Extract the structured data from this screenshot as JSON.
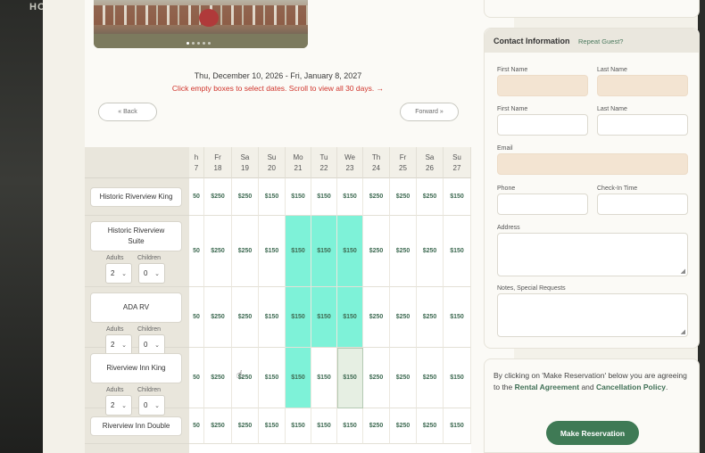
{
  "site": {
    "nav_fragment": "HO"
  },
  "booking": {
    "date_range": "Thu, December 10, 2026 - Fri, January 8, 2027",
    "hint": "Click empty boxes to select dates. Scroll to view all 30 days. →",
    "back_label": "« Back",
    "forward_label": "Forward »",
    "days": [
      {
        "dow": "h",
        "date": "7"
      },
      {
        "dow": "Fr",
        "date": "18"
      },
      {
        "dow": "Sa",
        "date": "19"
      },
      {
        "dow": "Su",
        "date": "20"
      },
      {
        "dow": "Mo",
        "date": "21"
      },
      {
        "dow": "Tu",
        "date": "22"
      },
      {
        "dow": "We",
        "date": "23"
      },
      {
        "dow": "Th",
        "date": "24"
      },
      {
        "dow": "Fr",
        "date": "25"
      },
      {
        "dow": "Sa",
        "date": "26"
      },
      {
        "dow": "Su",
        "date": "27"
      }
    ],
    "occupancy_labels": {
      "adults": "Adults",
      "children": "Children"
    },
    "rooms": [
      {
        "name": "Historic Riverview King",
        "has_selects": false,
        "prices": [
          "50",
          "$250",
          "$250",
          "$150",
          "$150",
          "$150",
          "$150",
          "$250",
          "$250",
          "$250",
          "$150"
        ],
        "state": [
          "",
          "",
          "",
          "",
          "",
          "",
          "",
          "",
          "",
          "",
          ""
        ]
      },
      {
        "name": "Historic Riverview Suite",
        "has_selects": true,
        "adults": "2",
        "children": "0",
        "prices": [
          "50",
          "$250",
          "$250",
          "$150",
          "$150",
          "$150",
          "$150",
          "$250",
          "$250",
          "$250",
          "$150"
        ],
        "state": [
          "",
          "",
          "",
          "",
          "sel",
          "sel",
          "sel",
          "",
          "",
          "",
          ""
        ]
      },
      {
        "name": "ADA RV",
        "has_selects": true,
        "adults": "2",
        "children": "0",
        "prices": [
          "50",
          "$250",
          "$250",
          "$150",
          "$150",
          "$150",
          "$150",
          "$250",
          "$250",
          "$250",
          "$150"
        ],
        "state": [
          "",
          "",
          "",
          "",
          "sel",
          "sel",
          "sel",
          "",
          "",
          "",
          ""
        ]
      },
      {
        "name": "Riverview Inn King",
        "has_selects": true,
        "adults": "2",
        "children": "0",
        "prices": [
          "50",
          "$250",
          "$250",
          "$150",
          "$150",
          "$150",
          "$150",
          "$250",
          "$250",
          "$250",
          "$150"
        ],
        "state": [
          "",
          "",
          "",
          "",
          "sel",
          "",
          "hover",
          "",
          "",
          "",
          ""
        ]
      },
      {
        "name": "Riverview Inn Double",
        "has_selects": false,
        "prices": [
          "50",
          "$250",
          "$250",
          "$150",
          "$150",
          "$150",
          "$150",
          "$250",
          "$250",
          "$250",
          "$150"
        ],
        "state": [
          "",
          "",
          "",
          "",
          "",
          "",
          "",
          "",
          "",
          "",
          ""
        ]
      }
    ]
  },
  "contact": {
    "title": "Contact Information",
    "repeat_guest": "Repeat Guest?",
    "first_name": "First Name",
    "last_name": "Last Name",
    "first_name_2": "First Name",
    "last_name_2": "Last Name",
    "email": "Email",
    "phone": "Phone",
    "checkin_time": "Check-In Time",
    "address": "Address",
    "notes": "Notes, Special Requests"
  },
  "terms": {
    "prefix": "By clicking on 'Make Reservation' below you are agreeing to the ",
    "rental_agreement": "Rental Agreement",
    "and": " and ",
    "cancellation_policy": "Cancellation Policy",
    "suffix": ".",
    "button": "Make Reservation"
  },
  "colors": {
    "selected": "#7ef2d8",
    "accent": "#3f7a55",
    "hint": "#d0342c",
    "required_field": "#f3e4d2"
  }
}
